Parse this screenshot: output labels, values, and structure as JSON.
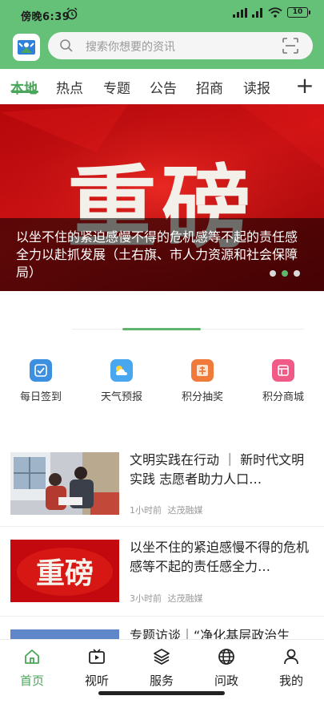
{
  "status": {
    "time": "傍晚6:39",
    "battery": "10"
  },
  "search": {
    "placeholder": "搜索你想要的资讯"
  },
  "tabs": [
    {
      "label": "本地",
      "active": true
    },
    {
      "label": "热点"
    },
    {
      "label": "专题"
    },
    {
      "label": "公告"
    },
    {
      "label": "招商"
    },
    {
      "label": "读报"
    }
  ],
  "banner": {
    "big_text": "重磅",
    "caption": "以坐不住的紧迫感慢不得的危机感等不起的责任感全力以赴抓发展（土右旗、市人力资源和社会保障局）",
    "slides": 3,
    "active_slide": 2
  },
  "quick_actions": [
    {
      "label": "每日签到",
      "icon": "sign-in-icon",
      "color": "#3d8fe0"
    },
    {
      "label": "天气预报",
      "icon": "weather-icon",
      "color": "#49a7ef"
    },
    {
      "label": "积分抽奖",
      "icon": "lottery-icon",
      "color": "#f07a3a"
    },
    {
      "label": "积分商城",
      "icon": "shop-icon",
      "color": "#ef5a86"
    }
  ],
  "news": [
    {
      "title": "文明实践在行动 ｜ 新时代文明实践 志愿者助力人口…",
      "time": "1小时前",
      "source": "达茂融媒"
    },
    {
      "title": "以坐不住的紧迫感慢不得的危机感等不起的责任感全力…",
      "time": "3小时前",
      "source": "达茂融媒",
      "thumb_text": "重磅"
    },
    {
      "title": "专题访谈｜“净化基层政治生"
    }
  ],
  "bottom_nav": [
    {
      "label": "首页",
      "icon": "home-icon",
      "active": true
    },
    {
      "label": "视听",
      "icon": "video-icon"
    },
    {
      "label": "服务",
      "icon": "layers-icon"
    },
    {
      "label": "问政",
      "icon": "globe-icon"
    },
    {
      "label": "我的",
      "icon": "person-icon"
    }
  ],
  "colors": {
    "header": "#66c178",
    "accent": "#4aa65a",
    "banner": "#c80f12"
  }
}
